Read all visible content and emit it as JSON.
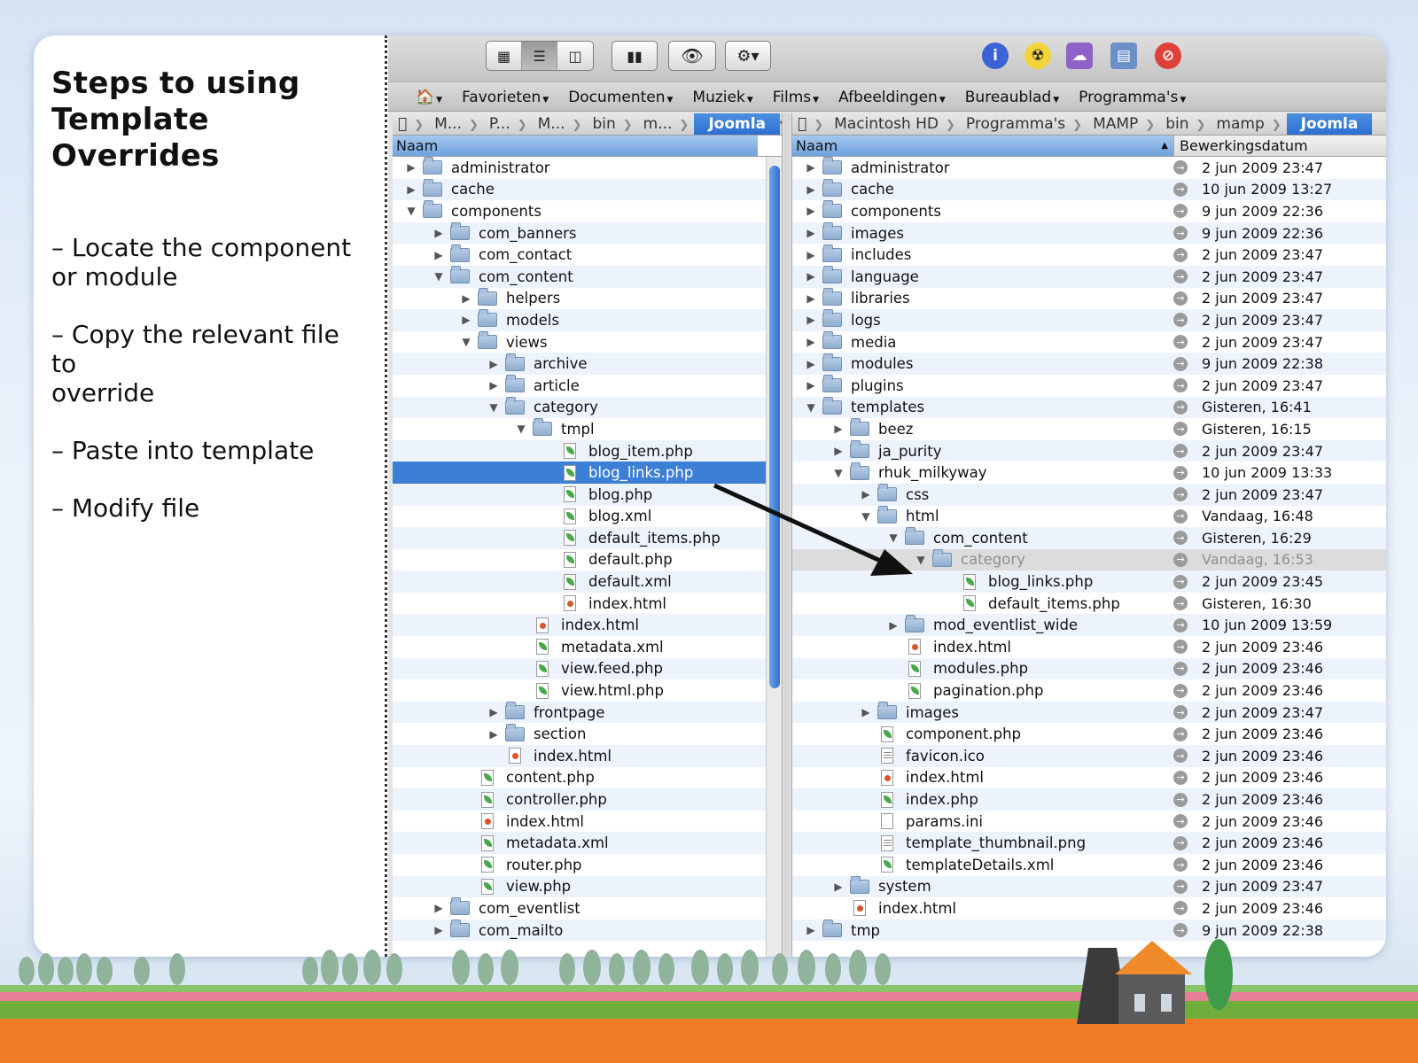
{
  "slide": {
    "title": "Steps to using\nTemplate Overrides",
    "steps": [
      "– Locate the component\nor module",
      "– Copy the relevant file to\noverride",
      "– Paste into template",
      "– Modify file"
    ]
  },
  "toolbar": {
    "view_icons": [
      "icon-view-icon",
      "list-view-icon",
      "column-view-icon"
    ],
    "coverflow_icon": "coverflow-icon",
    "quicklook_icon": "eye-icon",
    "action_icon": "gear-icon",
    "right_icons": [
      "info-icon",
      "burn-icon",
      "cloud-drive-icon",
      "window-icon",
      "stop-icon"
    ]
  },
  "favorites": [
    "Favorieten",
    "Documenten",
    "Muziek",
    "Films",
    "Afbeeldingen",
    "Bureaublad",
    "Programma's"
  ],
  "left_pane": {
    "path": [
      "M...",
      "P...",
      "M...",
      "bin",
      "m..."
    ],
    "path_current": "Joomla",
    "column_name": "Naam",
    "rows": [
      {
        "name": "administrator",
        "type": "folder",
        "depth": 0,
        "state": "closed"
      },
      {
        "name": "cache",
        "type": "folder",
        "depth": 0,
        "state": "closed"
      },
      {
        "name": "components",
        "type": "folder",
        "depth": 0,
        "state": "open"
      },
      {
        "name": "com_banners",
        "type": "folder",
        "depth": 1,
        "state": "closed"
      },
      {
        "name": "com_contact",
        "type": "folder",
        "depth": 1,
        "state": "closed"
      },
      {
        "name": "com_content",
        "type": "folder",
        "depth": 1,
        "state": "open"
      },
      {
        "name": "helpers",
        "type": "folder",
        "depth": 2,
        "state": "closed"
      },
      {
        "name": "models",
        "type": "folder",
        "depth": 2,
        "state": "closed"
      },
      {
        "name": "views",
        "type": "folder",
        "depth": 2,
        "state": "open"
      },
      {
        "name": "archive",
        "type": "folder",
        "depth": 3,
        "state": "closed"
      },
      {
        "name": "article",
        "type": "folder",
        "depth": 3,
        "state": "closed"
      },
      {
        "name": "category",
        "type": "folder",
        "depth": 3,
        "state": "open"
      },
      {
        "name": "tmpl",
        "type": "folder",
        "depth": 4,
        "state": "open"
      },
      {
        "name": "blog_item.php",
        "type": "php",
        "depth": 5
      },
      {
        "name": "blog_links.php",
        "type": "php",
        "depth": 5,
        "selected": true
      },
      {
        "name": "blog.php",
        "type": "php",
        "depth": 5
      },
      {
        "name": "blog.xml",
        "type": "php",
        "depth": 5
      },
      {
        "name": "default_items.php",
        "type": "php",
        "depth": 5
      },
      {
        "name": "default.php",
        "type": "php",
        "depth": 5
      },
      {
        "name": "default.xml",
        "type": "php",
        "depth": 5
      },
      {
        "name": "index.html",
        "type": "html",
        "depth": 5
      },
      {
        "name": "index.html",
        "type": "html",
        "depth": 4
      },
      {
        "name": "metadata.xml",
        "type": "php",
        "depth": 4
      },
      {
        "name": "view.feed.php",
        "type": "php",
        "depth": 4
      },
      {
        "name": "view.html.php",
        "type": "php",
        "depth": 4
      },
      {
        "name": "frontpage",
        "type": "folder",
        "depth": 3,
        "state": "closed"
      },
      {
        "name": "section",
        "type": "folder",
        "depth": 3,
        "state": "closed"
      },
      {
        "name": "index.html",
        "type": "html",
        "depth": 3
      },
      {
        "name": "content.php",
        "type": "php",
        "depth": 2
      },
      {
        "name": "controller.php",
        "type": "php",
        "depth": 2
      },
      {
        "name": "index.html",
        "type": "html",
        "depth": 2
      },
      {
        "name": "metadata.xml",
        "type": "php",
        "depth": 2
      },
      {
        "name": "router.php",
        "type": "php",
        "depth": 2
      },
      {
        "name": "view.php",
        "type": "php",
        "depth": 2
      },
      {
        "name": "com_eventlist",
        "type": "folder",
        "depth": 1,
        "state": "closed"
      },
      {
        "name": "com_mailto",
        "type": "folder",
        "depth": 1,
        "state": "closed"
      }
    ]
  },
  "right_pane": {
    "path": [
      "Macintosh HD",
      "Programma's",
      "MAMP",
      "bin",
      "mamp"
    ],
    "path_current": "Joomla",
    "column_name": "Naam",
    "column_date": "Bewerkingsdatum",
    "rows": [
      {
        "name": "administrator",
        "type": "folder",
        "depth": 0,
        "state": "closed",
        "date": "2 jun 2009 23:47"
      },
      {
        "name": "cache",
        "type": "folder",
        "depth": 0,
        "state": "closed",
        "date": "10 jun 2009 13:27"
      },
      {
        "name": "components",
        "type": "folder",
        "depth": 0,
        "state": "closed",
        "date": "9 jun 2009 22:36"
      },
      {
        "name": "images",
        "type": "folder",
        "depth": 0,
        "state": "closed",
        "date": "9 jun 2009 22:36"
      },
      {
        "name": "includes",
        "type": "folder",
        "depth": 0,
        "state": "closed",
        "date": "2 jun 2009 23:47"
      },
      {
        "name": "language",
        "type": "folder",
        "depth": 0,
        "state": "closed",
        "date": "2 jun 2009 23:47"
      },
      {
        "name": "libraries",
        "type": "folder",
        "depth": 0,
        "state": "closed",
        "date": "2 jun 2009 23:47"
      },
      {
        "name": "logs",
        "type": "folder",
        "depth": 0,
        "state": "closed",
        "date": "2 jun 2009 23:47"
      },
      {
        "name": "media",
        "type": "folder",
        "depth": 0,
        "state": "closed",
        "date": "2 jun 2009 23:47"
      },
      {
        "name": "modules",
        "type": "folder",
        "depth": 0,
        "state": "closed",
        "date": "9 jun 2009 22:38"
      },
      {
        "name": "plugins",
        "type": "folder",
        "depth": 0,
        "state": "closed",
        "date": "2 jun 2009 23:47"
      },
      {
        "name": "templates",
        "type": "folder",
        "depth": 0,
        "state": "open",
        "date": "Gisteren, 16:41"
      },
      {
        "name": "beez",
        "type": "folder",
        "depth": 1,
        "state": "closed",
        "date": "Gisteren, 16:15"
      },
      {
        "name": "ja_purity",
        "type": "folder",
        "depth": 1,
        "state": "closed",
        "date": "2 jun 2009 23:47"
      },
      {
        "name": "rhuk_milkyway",
        "type": "folder",
        "depth": 1,
        "state": "open",
        "date": "10 jun 2009 13:33"
      },
      {
        "name": "css",
        "type": "folder",
        "depth": 2,
        "state": "closed",
        "date": "2 jun 2009 23:47"
      },
      {
        "name": "html",
        "type": "folder",
        "depth": 2,
        "state": "open",
        "date": "Vandaag, 16:48"
      },
      {
        "name": "com_content",
        "type": "folder",
        "depth": 3,
        "state": "open",
        "date": "Gisteren, 16:29"
      },
      {
        "name": "category",
        "type": "folder",
        "depth": 4,
        "state": "open",
        "date": "Vandaag, 16:53",
        "dim": true
      },
      {
        "name": "blog_links.php",
        "type": "php",
        "depth": 5,
        "date": "2 jun 2009 23:45"
      },
      {
        "name": "default_items.php",
        "type": "php",
        "depth": 5,
        "date": "Gisteren, 16:30"
      },
      {
        "name": "mod_eventlist_wide",
        "type": "folder",
        "depth": 3,
        "state": "closed",
        "date": "10 jun 2009 13:59"
      },
      {
        "name": "index.html",
        "type": "html",
        "depth": 3,
        "date": "2 jun 2009 23:46"
      },
      {
        "name": "modules.php",
        "type": "php",
        "depth": 3,
        "date": "2 jun 2009 23:46"
      },
      {
        "name": "pagination.php",
        "type": "php",
        "depth": 3,
        "date": "2 jun 2009 23:46"
      },
      {
        "name": "images",
        "type": "folder",
        "depth": 2,
        "state": "closed",
        "date": "2 jun 2009 23:47"
      },
      {
        "name": "component.php",
        "type": "php",
        "depth": 2,
        "date": "2 jun 2009 23:46"
      },
      {
        "name": "favicon.ico",
        "type": "doc",
        "depth": 2,
        "date": "2 jun 2009 23:46"
      },
      {
        "name": "index.html",
        "type": "html",
        "depth": 2,
        "date": "2 jun 2009 23:46"
      },
      {
        "name": "index.php",
        "type": "php",
        "depth": 2,
        "date": "2 jun 2009 23:46"
      },
      {
        "name": "params.ini",
        "type": "blank",
        "depth": 2,
        "date": "2 jun 2009 23:46"
      },
      {
        "name": "template_thumbnail.png",
        "type": "doc",
        "depth": 2,
        "date": "2 jun 2009 23:46"
      },
      {
        "name": "templateDetails.xml",
        "type": "php",
        "depth": 2,
        "date": "2 jun 2009 23:46"
      },
      {
        "name": "system",
        "type": "folder",
        "depth": 1,
        "state": "closed",
        "date": "2 jun 2009 23:47"
      },
      {
        "name": "index.html",
        "type": "html",
        "depth": 1,
        "date": "2 jun 2009 23:46"
      },
      {
        "name": "tmp",
        "type": "folder",
        "depth": 0,
        "state": "closed",
        "date": "9 jun 2009 22:38"
      }
    ]
  },
  "colors": {
    "selection": "#3d7fd4",
    "row_alt": "#edf3fd",
    "php_leaf": "#4aa84a",
    "html_dot": "#d6552a"
  }
}
